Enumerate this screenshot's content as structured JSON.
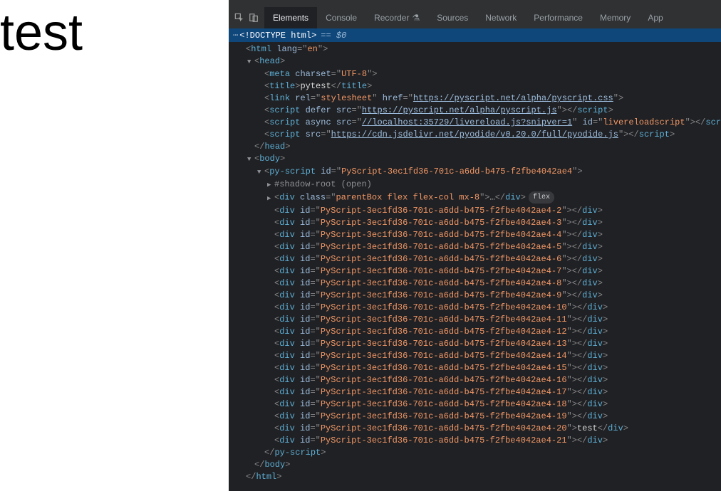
{
  "page": {
    "text": "test"
  },
  "tabs": [
    "Elements",
    "Console",
    "Recorder",
    "Sources",
    "Network",
    "Performance",
    "Memory",
    "App"
  ],
  "activeTab": "Elements",
  "doctype": {
    "label": "<!DOCTYPE html>",
    "eq": " == ",
    "sel": "$0"
  },
  "html": {
    "lang": "en"
  },
  "head": {
    "meta_charset": "UTF-8",
    "title": "pytest",
    "link": {
      "rel": "stylesheet",
      "href": "https://pyscript.net/alpha/pyscript.css"
    },
    "script1": {
      "defer": "defer",
      "src": "https://pyscript.net/alpha/pyscript.js"
    },
    "script2": {
      "async": "async",
      "src": "//localhost:35729/livereload.js?snipver=1",
      "id": "livereloadscript"
    },
    "script3": {
      "src": "https://cdn.jsdelivr.net/pyodide/v0.20.0/full/pyodide.js"
    }
  },
  "pyscript": {
    "id": "PyScript-3ec1fd36-701c-a6dd-b475-f2fbe4042ae4",
    "shadow": "#shadow-root (open)",
    "parentClass": "parentBox flex flex-col mx-8",
    "pill": "flex",
    "base": "PyScript-3ec1fd36-701c-a6dd-b475-f2fbe4042ae4-",
    "divs": [
      {
        "n": "2",
        "t": ""
      },
      {
        "n": "3",
        "t": ""
      },
      {
        "n": "4",
        "t": ""
      },
      {
        "n": "5",
        "t": ""
      },
      {
        "n": "6",
        "t": ""
      },
      {
        "n": "7",
        "t": ""
      },
      {
        "n": "8",
        "t": ""
      },
      {
        "n": "9",
        "t": ""
      },
      {
        "n": "10",
        "t": ""
      },
      {
        "n": "11",
        "t": ""
      },
      {
        "n": "12",
        "t": ""
      },
      {
        "n": "13",
        "t": ""
      },
      {
        "n": "14",
        "t": ""
      },
      {
        "n": "15",
        "t": ""
      },
      {
        "n": "16",
        "t": ""
      },
      {
        "n": "17",
        "t": ""
      },
      {
        "n": "18",
        "t": ""
      },
      {
        "n": "19",
        "t": ""
      },
      {
        "n": "20",
        "t": "test"
      },
      {
        "n": "21",
        "t": ""
      }
    ]
  },
  "labels": {
    "html": "html",
    "head": "head",
    "meta": "meta",
    "title": "title",
    "link": "link",
    "script": "script",
    "body": "body",
    "pyscript": "py-script",
    "div": "div",
    "lang": "lang",
    "charset": "charset",
    "rel": "rel",
    "href": "href",
    "defer": "defer",
    "src": "src",
    "async": "async",
    "id": "id",
    "class": "class",
    "ellipsis": "…"
  }
}
